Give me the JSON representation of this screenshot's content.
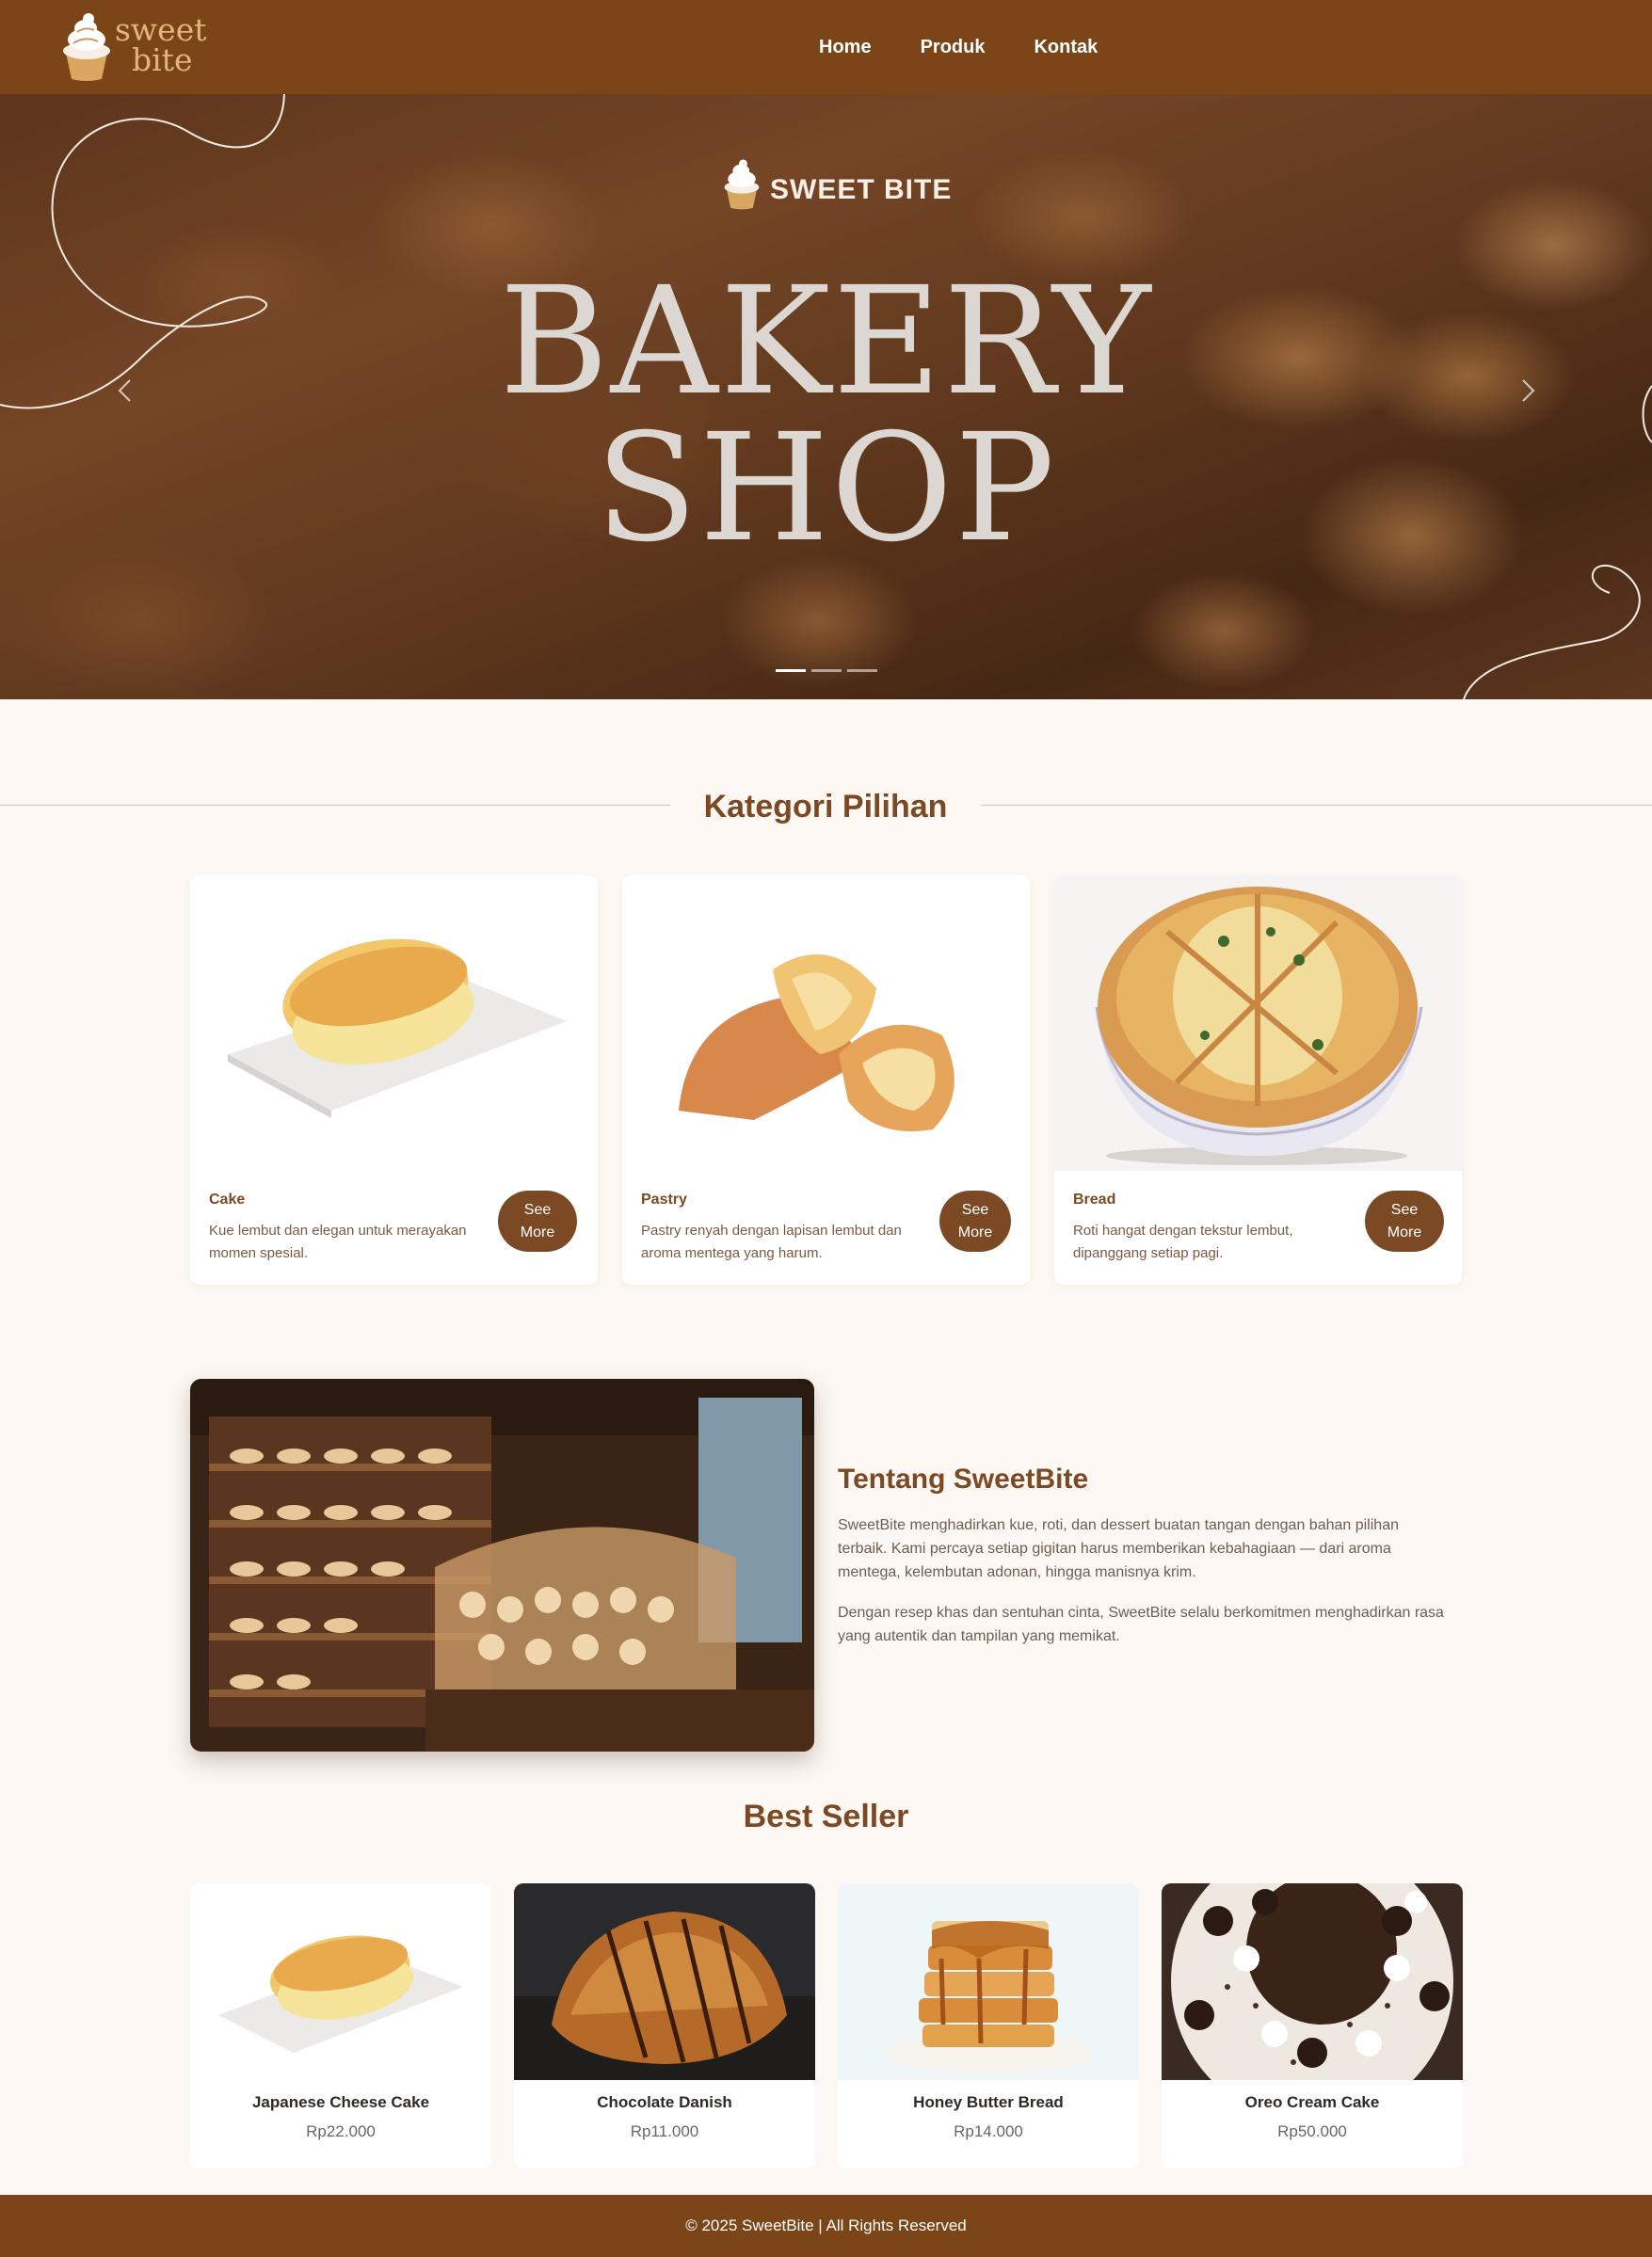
{
  "brand": {
    "logo_line1": "sweet",
    "logo_line2": "bite"
  },
  "nav": {
    "items": [
      "Home",
      "Produk",
      "Kontak"
    ]
  },
  "hero": {
    "brand": "SWEET BITE",
    "title_line1": "BAKERY",
    "title_line2": "SHOP",
    "slides": 3,
    "active_slide": 1
  },
  "kategori": {
    "title": "Kategori Pilihan",
    "cards": [
      {
        "name": "Cake",
        "desc": "Kue lembut dan elegan untuk merayakan momen spesial.",
        "button_l1": "See",
        "button_l2": "More"
      },
      {
        "name": "Pastry",
        "desc": "Pastry renyah dengan lapisan lembut dan aroma mentega yang harum.",
        "button_l1": "See",
        "button_l2": "More"
      },
      {
        "name": "Bread",
        "desc": "Roti hangat dengan tekstur lembut, dipanggang setiap pagi.",
        "button_l1": "See",
        "button_l2": "More"
      }
    ]
  },
  "tentang": {
    "title": "Tentang SweetBite",
    "p1": "SweetBite menghadirkan kue, roti, dan dessert buatan tangan dengan bahan pilihan terbaik. Kami percaya setiap gigitan harus memberikan kebahagiaan — dari aroma mentega, kelembutan adonan, hingga manisnya krim.",
    "p2": "Dengan resep khas dan sentuhan cinta, SweetBite selalu berkomitmen menghadirkan rasa yang autentik dan tampilan yang memikat."
  },
  "best_seller": {
    "title": "Best Seller",
    "items": [
      {
        "name": "Japanese Cheese Cake",
        "price": "Rp22.000"
      },
      {
        "name": "Chocolate Danish",
        "price": "Rp11.000"
      },
      {
        "name": "Honey Butter Bread",
        "price": "Rp14.000"
      },
      {
        "name": "Oreo Cream Cake",
        "price": "Rp50.000"
      }
    ]
  },
  "footer": {
    "text": "© 2025 SweetBite | All Rights Reserved"
  },
  "colors": {
    "brown": "#7b4518",
    "accent": "#7b4a25",
    "background": "#fdf8f3",
    "logo_gold": "#e2b57c"
  },
  "icons": [
    "cupcake-logo-icon",
    "chevron-left-icon",
    "chevron-right-icon"
  ]
}
